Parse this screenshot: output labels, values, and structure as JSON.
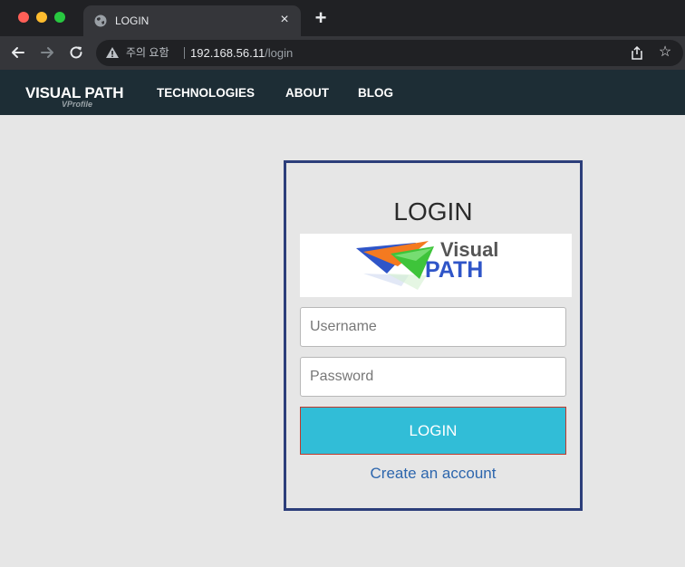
{
  "browser": {
    "tab_title": "LOGIN",
    "tab_close": "×",
    "new_tab": "+",
    "security_warning": "주의 요함",
    "url_host": "192.168.56.11",
    "url_path": "/login",
    "star": "☆"
  },
  "navbar": {
    "brand": "VISUAL PATH",
    "brand_sub": "VProfile",
    "links": [
      "TECHNOLOGIES",
      "ABOUT",
      "BLOG"
    ]
  },
  "login": {
    "title": "LOGIN",
    "logo_text_top": "Visual",
    "logo_text_bottom": "PATH",
    "username_placeholder": "Username",
    "password_placeholder": "Password",
    "button_label": "LOGIN",
    "create_account": "Create an account"
  }
}
